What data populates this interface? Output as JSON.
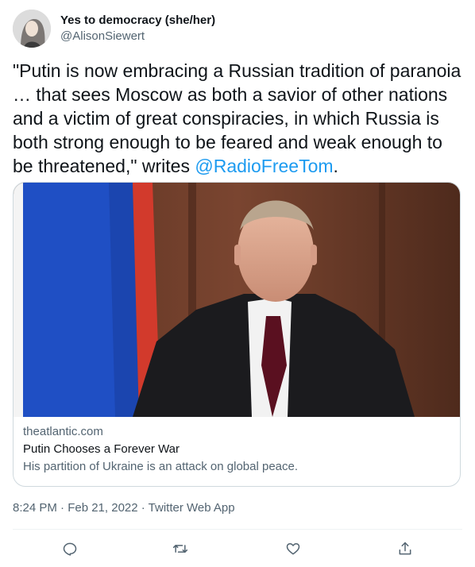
{
  "tweet": {
    "display_name": "Yes to democracy (she/her)",
    "handle": "@AlisonSiewert",
    "text_body": "\"Putin is now embracing a Russian tradition of paranoia … that sees Moscow as both a savior of other nations and a victim of great conspiracies, in which Russia is both strong enough to be feared and weak enough to be threatened,\" writes ",
    "mention": "@RadioFreeTom",
    "text_tail": ".",
    "timestamp": "8:24 PM · Feb 21, 2022 · Twitter Web App"
  },
  "card": {
    "domain": "theatlantic.com",
    "title": "Putin Chooses a Forever War",
    "description": "His partition of Ukraine is an attack on global peace."
  },
  "actions": {
    "reply_icon": "reply-icon",
    "retweet_icon": "retweet-icon",
    "like_icon": "like-icon",
    "share_icon": "share-icon"
  },
  "colors": {
    "accent": "#1d9bf0",
    "text": "#0f1419",
    "secondary": "#536471",
    "border": "#cfd9de"
  }
}
